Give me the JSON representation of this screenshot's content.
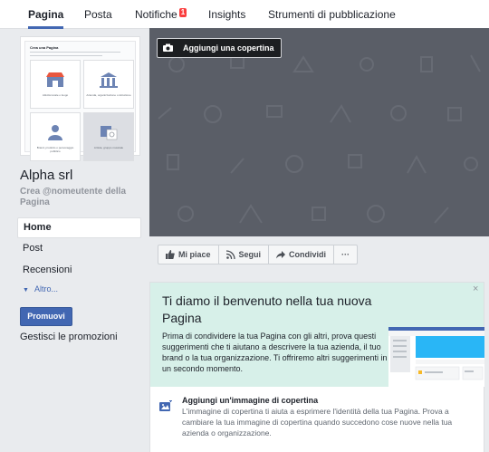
{
  "topbar": {
    "tabs": [
      {
        "label": "Pagina",
        "active": true
      },
      {
        "label": "Posta",
        "active": false
      },
      {
        "label": "Notifiche",
        "badge": "1",
        "active": false
      },
      {
        "label": "Insights",
        "active": false
      },
      {
        "label": "Strumenti di pubblicazione",
        "active": false
      }
    ]
  },
  "thumbnail": {
    "title": "Crea una Pagina",
    "cards": [
      {
        "label": "Attività locale o luogo",
        "icon": "storefront-icon"
      },
      {
        "label": "Azienda, organizzazione o istituzione",
        "icon": "building-icon"
      },
      {
        "label": "Brand, prodotto o personaggio pubblico",
        "icon": "person-icon"
      },
      {
        "label": "Artista, gruppo musicale",
        "icon": "photo-icon"
      }
    ]
  },
  "sidebar": {
    "page_name": "Alpha srl",
    "handle": "Crea @nomeutente della Pagina",
    "items": [
      {
        "label": "Home",
        "active": true
      },
      {
        "label": "Post"
      },
      {
        "label": "Recensioni"
      }
    ],
    "more_label": "Altro...",
    "promote_label": "Promuovi",
    "manage_promotions_label": "Gestisci le promozioni"
  },
  "cover": {
    "add_cover_label": "Aggiungi una copertina"
  },
  "actions": {
    "like_label": "Mi piace",
    "follow_label": "Segui",
    "share_label": "Condividi",
    "more_label": "···"
  },
  "welcome": {
    "close_label": "×",
    "title": "Ti diamo il benvenuto nella tua nuova Pagina",
    "text": "Prima di condividere la tua Pagina con gli altri, prova questi suggerimenti che ti aiutano a descrivere la tua azienda, il tuo brand o la tua organizzazione. Ti offriremo altri suggerimenti in un secondo momento.",
    "step_title": "Aggiungi un'immagine di copertina",
    "step_desc": "L'immagine di copertina ti aiuta a esprimere l'identità della tua Pagina. Prova a cambiare la tua immagine di copertina quando succedono cose nuove nella tua azienda o organizzazione."
  },
  "colors": {
    "accent": "#4267b2",
    "badge": "#fa3e3e",
    "cover": "#5a5e67",
    "welcome_bg": "#d7f0e9"
  }
}
